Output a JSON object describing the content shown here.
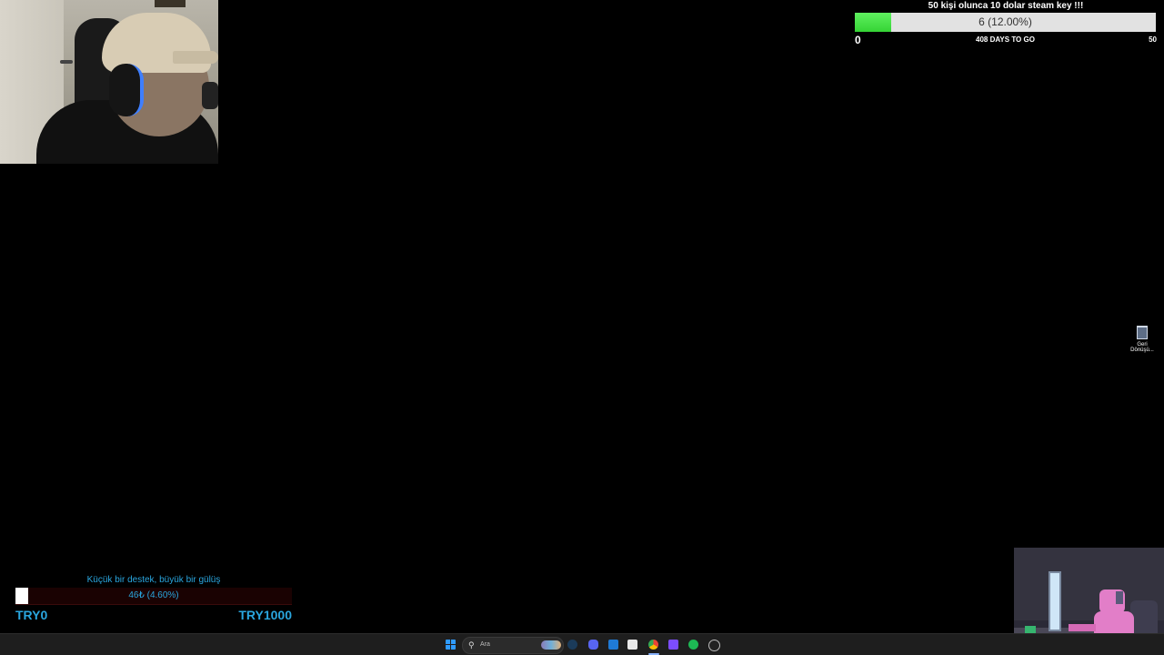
{
  "webcam": {},
  "stream_goal": {
    "title": "50 kişi olunca 10 dolar steam key !!!",
    "progress_text": "6 (12.00%)",
    "progress_fraction": 0.12,
    "fill_color": "#44e044",
    "min": "0",
    "days_left": "408 DAYS TO GO",
    "max": "50"
  },
  "desktop": {
    "recycle_bin_label": "Geri Dönüşü..."
  },
  "donation_goal": {
    "title": "Küçük bir destek, büyük bir gülüş",
    "progress_text": "46₺ (4.60%)",
    "progress_fraction": 0.046,
    "accent_color": "#2aa6df",
    "min": "TRY0",
    "max": "TRY1000"
  },
  "taskbar": {
    "search_placeholder": "Ara",
    "icons": [
      "windows-start-icon",
      "search-icon",
      "steam-icon",
      "discord-icon",
      "files-icon",
      "snipping-tool-icon",
      "chrome-icon",
      "visual-studio-icon",
      "spotify-icon",
      "obs-icon"
    ]
  }
}
